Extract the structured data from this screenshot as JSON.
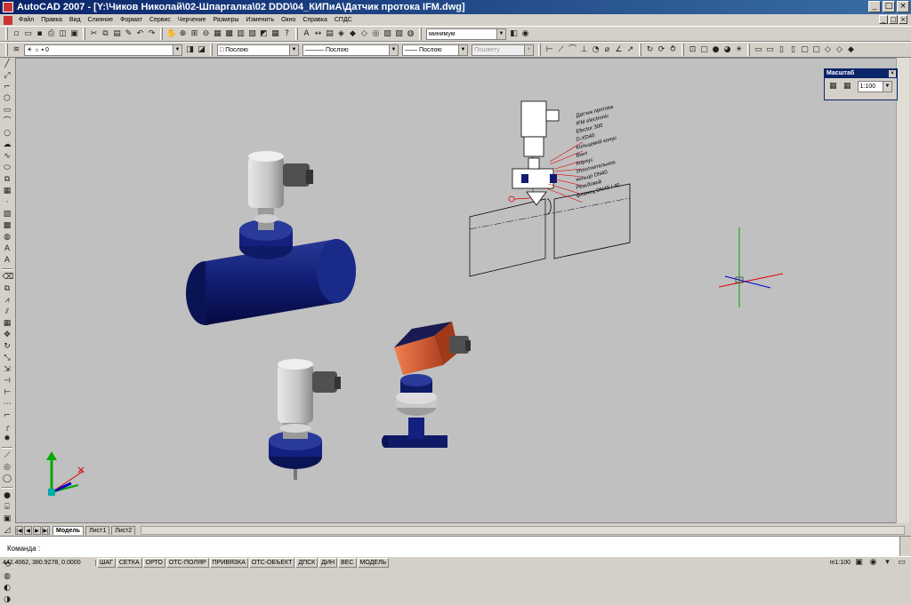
{
  "window": {
    "title": "AutoCAD 2007 - [Y:\\Чиков Николай\\02-Шпаргалка\\02 DDD\\04_КИПиА\\Датчик протока IFM.dwg]"
  },
  "menu": [
    "Файл",
    "Правка",
    "Вид",
    "Слияние",
    "Формат",
    "Сервис",
    "Черчение",
    "Размеры",
    "Изменить",
    "Окно",
    "Справка",
    "СПДС"
  ],
  "toolbar": {
    "visual_style": "минимум",
    "layer": "0",
    "color": "Послою",
    "linetype": "Послою",
    "lineweight": "Послою",
    "plotstyle": "Пошвету"
  },
  "scale_panel": {
    "title": "Масштаб",
    "value": "1:100"
  },
  "callout": {
    "lines": [
      "Датчик протока",
      "IFM electronic",
      "Efector 300",
      "D-XD40",
      "Кольцевой конус",
      "Винт",
      "Корпус",
      "Уплотнительное",
      "кольцо DN40",
      "Резьбовой",
      "фланец DN40 / 40"
    ]
  },
  "tabs": [
    "Модель",
    "Лист1",
    "Лист2"
  ],
  "command": {
    "prompt": "Команда :"
  },
  "status": {
    "coords": "442.4062, 380.9278, 0.0000",
    "buttons": [
      "ШАГ",
      "СЕТКА",
      "ОРТО",
      "ОТС-ПОЛЯР",
      "ПРИВЯЗКА",
      "ОТС-ОБЪЕКТ",
      "ДПСК",
      "ДИН",
      "ВЕС",
      "МОДЕЛЬ"
    ],
    "scale": "m1:100"
  },
  "colors": {
    "pipe": "#101c70",
    "sensor": "#c8c8c8",
    "orange": "#e06a3a",
    "canvas": "#c0c0c0"
  }
}
